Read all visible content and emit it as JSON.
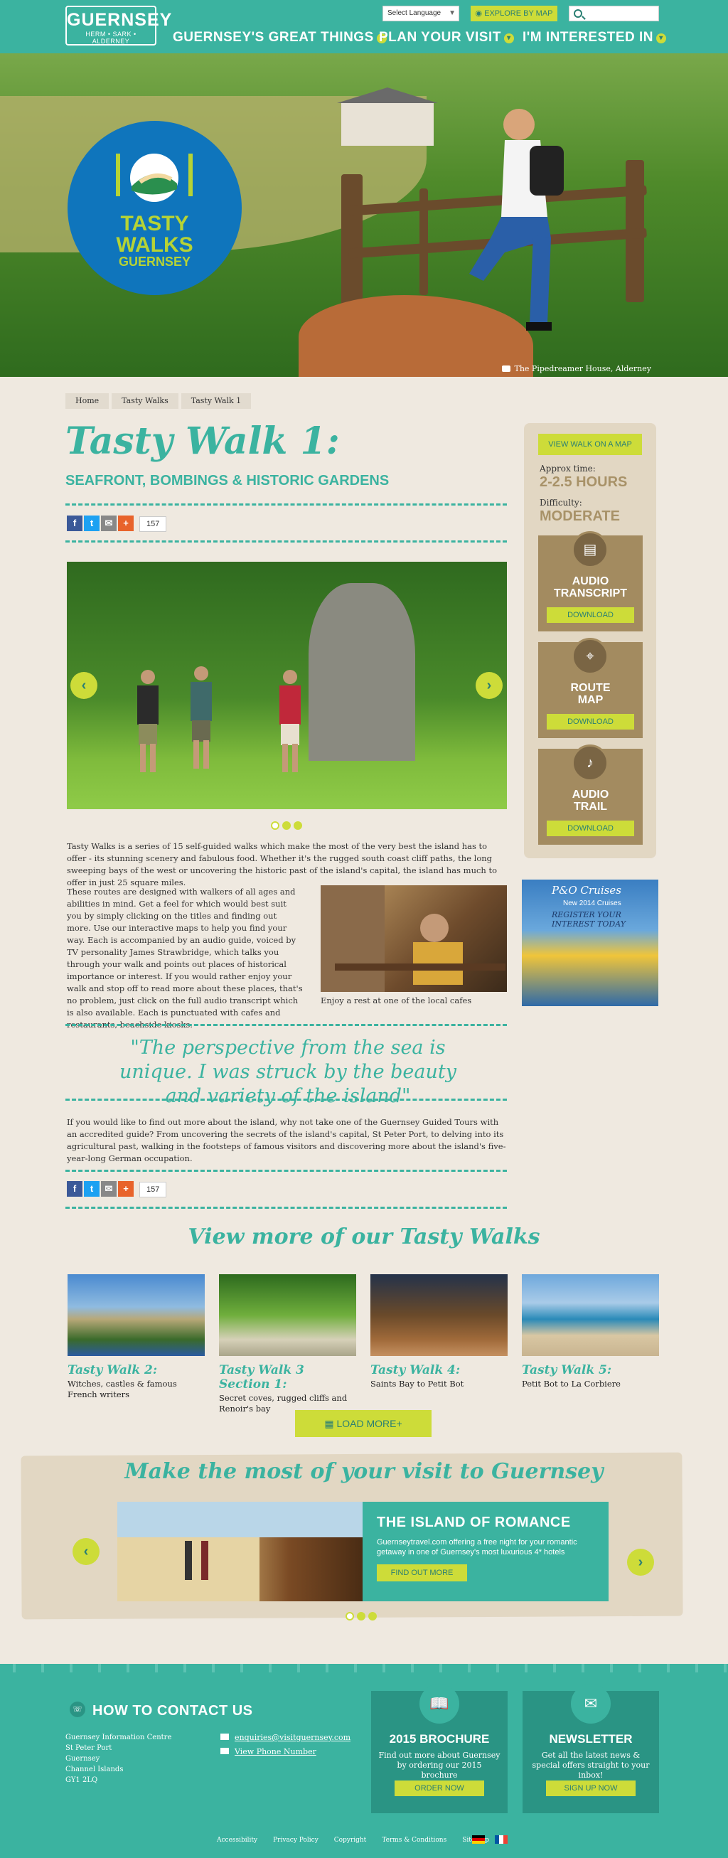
{
  "header": {
    "logo_main": "GUERNSEY",
    "logo_sub": "HERM • SARK • ALDERNEY",
    "language": "Select Language",
    "explore": "EXPLORE BY MAP",
    "search_placeholder": "",
    "nav": [
      "GUERNSEY'S GREAT THINGS",
      "PLAN YOUR VISIT",
      "I'M INTERESTED IN"
    ]
  },
  "hero": {
    "badge_line1": "TASTY",
    "badge_line2": "WALKS",
    "badge_line3": "GUERNSEY",
    "caption": "The Pipedreamer House, Alderney"
  },
  "breadcrumb": [
    "Home",
    "Tasty Walks",
    "Tasty Walk 1"
  ],
  "article": {
    "title": "Tasty Walk 1:",
    "subtitle": "SEAFRONT, BOMBINGS & HISTORIC GARDENS",
    "share_count": "157",
    "intro": "Tasty Walks is a series of 15 self-guided walks which make the most of the very best the island has to offer - its stunning scenery and fabulous food. Whether it's the rugged south coast cliff paths, the long sweeping bays of the west or uncovering the historic past of the island's capital, the island has much to offer in just 25 square miles.",
    "body": "These routes are designed with walkers of all ages and abilities in mind. Get a feel for which would best suit you by simply clicking on the titles and finding out more. Use our interactive maps to help you find your way. Each is accompanied by an audio guide, voiced by TV personality James Strawbridge, which talks you through your walk and points out places of historical importance or interest. If you would rather enjoy your walk and stop off to read more about these places, that's no problem, just click on the full audio transcript which is also available. Each is punctuated with cafes and restaurants, beachside kiosks.",
    "image_caption": "Enjoy a rest at one of the local cafes",
    "quote": "\"The perspective from the sea is unique. I was struck by the beauty and variety of the island\"",
    "outro": "If you would like to find out more about the island, why not take one of the Guernsey Guided Tours with an accredited guide? From uncovering the secrets of the island's capital, St Peter Port, to delving into its agricultural past, walking in the footsteps of famous visitors and discovering more about the island's five-year-long German occupation."
  },
  "sidebar": {
    "map_button": "VIEW WALK ON A MAP",
    "time_label": "Approx time:",
    "time_value": "2-2.5 HOURS",
    "difficulty_label": "Difficulty:",
    "difficulty_value": "MODERATE",
    "downloads": [
      {
        "label1": "AUDIO",
        "label2": "TRANSCRIPT",
        "button": "DOWNLOAD",
        "icon": "document-icon"
      },
      {
        "label1": "ROUTE",
        "label2": "MAP",
        "button": "DOWNLOAD",
        "icon": "map-pin-icon"
      },
      {
        "label1": "AUDIO",
        "label2": "TRAIL",
        "button": "DOWNLOAD",
        "icon": "music-note-icon"
      }
    ],
    "ad": {
      "brand": "P&O Cruises",
      "line1": "New 2014 Cruises",
      "line2": "REGISTER YOUR",
      "line3": "INTEREST TODAY"
    }
  },
  "more_walks": {
    "title": "View more of our Tasty Walks",
    "cards": [
      {
        "title": "Tasty Walk 2:",
        "desc": "Witches, castles & famous French writers"
      },
      {
        "title": "Tasty Walk 3 Section 1:",
        "desc": "Secret coves, rugged cliffs and Renoir's bay"
      },
      {
        "title": "Tasty Walk 4:",
        "desc": "Saints Bay to Petit Bot"
      },
      {
        "title": "Tasty Walk 5:",
        "desc": "Petit Bot to La Corbiere"
      }
    ],
    "load_more": "LOAD MORE+"
  },
  "promo": {
    "band_title": "Make the most of your visit to Guernsey",
    "heading": "THE ISLAND OF ROMANCE",
    "text": "Guernseytravel.com offering a free night for your romantic getaway in one of Guernsey's most luxurious 4* hotels",
    "button": "FIND OUT MORE"
  },
  "footer": {
    "contact_title": "HOW TO CONTACT US",
    "address": [
      "Guernsey Information Centre",
      "St Peter Port",
      "Guernsey",
      "Channel Islands",
      "GY1 2LQ"
    ],
    "email": "enquiries@visitguernsey.com",
    "phone_link": "View Phone Number",
    "brochure": {
      "title": "2015 BROCHURE",
      "text": "Find out more about Guernsey by ordering our 2015 brochure",
      "button": "ORDER NOW"
    },
    "newsletter": {
      "title": "NEWSLETTER",
      "text": "Get all the latest news & special offers straight to your inbox!",
      "button": "SIGN UP NOW"
    },
    "links": [
      "Accessibility",
      "Privacy Policy",
      "Copyright",
      "Terms & Conditions",
      "Sitemap"
    ]
  },
  "colors": {
    "teal": "#3bb3a0",
    "lime": "#cddc39",
    "tan": "#a38b60",
    "sand": "#efe9e0"
  }
}
